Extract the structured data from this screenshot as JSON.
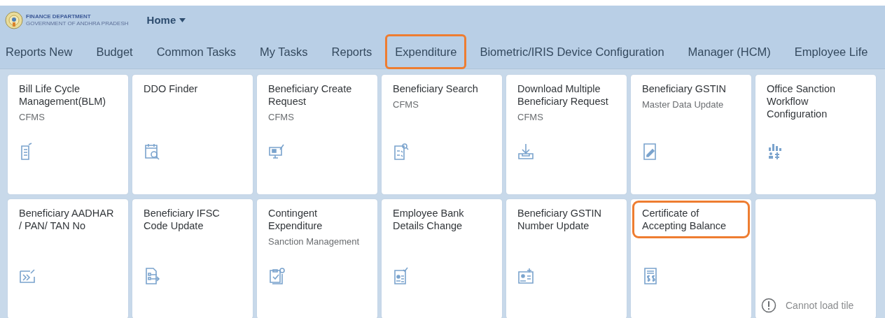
{
  "header": {
    "logo_title": "FINANCE DEPARTMENT",
    "logo_subtitle": "GOVERNMENT OF ANDHRA PRADESH",
    "menu": "Home"
  },
  "tabs": [
    {
      "label": "Reports New",
      "highlighted": false
    },
    {
      "label": "Budget",
      "highlighted": false
    },
    {
      "label": "Common Tasks",
      "highlighted": false
    },
    {
      "label": "My Tasks",
      "highlighted": false
    },
    {
      "label": "Reports",
      "highlighted": false
    },
    {
      "label": "Expenditure",
      "highlighted": true
    },
    {
      "label": "Biometric/IRIS Device Configuration",
      "highlighted": false
    },
    {
      "label": "Manager (HCM)",
      "highlighted": false
    },
    {
      "label": "Employee Life",
      "highlighted": false
    }
  ],
  "tiles": [
    {
      "kind": "app",
      "title": "Bill Life Cycle Management(BLM)",
      "subtitle": "CFMS",
      "highlighted": false
    },
    {
      "kind": "app",
      "title": "DDO Finder",
      "highlighted": false
    },
    {
      "kind": "app",
      "title": "Beneficiary Create Request",
      "subtitle": "CFMS",
      "highlighted": false
    },
    {
      "kind": "app",
      "title": "Beneficiary Search",
      "subtitle": "CFMS",
      "highlighted": false
    },
    {
      "kind": "app",
      "title": "Download Multiple Beneficiary Request",
      "subtitle": "CFMS",
      "highlighted": false
    },
    {
      "kind": "app",
      "title": "Beneficiary GSTIN",
      "subtitle": "Master Data Update",
      "highlighted": false
    },
    {
      "kind": "app",
      "title": "Office Sanction Workflow Configuration",
      "highlighted": false
    },
    {
      "kind": "app",
      "title": "Beneficiary AADHAR / PAN/ TAN No",
      "highlighted": false
    },
    {
      "kind": "app",
      "title": "Beneficiary IFSC Code Update",
      "highlighted": false
    },
    {
      "kind": "app",
      "title": "Contingent Expenditure",
      "subtitle": "Sanction Management",
      "highlighted": false
    },
    {
      "kind": "app",
      "title": "Employee Bank Details Change",
      "highlighted": false
    },
    {
      "kind": "app",
      "title": "Beneficiary GSTIN Number Update",
      "highlighted": false
    },
    {
      "kind": "app",
      "title": "Certificate of Accepting Balance",
      "highlighted": true
    },
    {
      "kind": "error",
      "message": "Cannot load tile"
    }
  ]
}
